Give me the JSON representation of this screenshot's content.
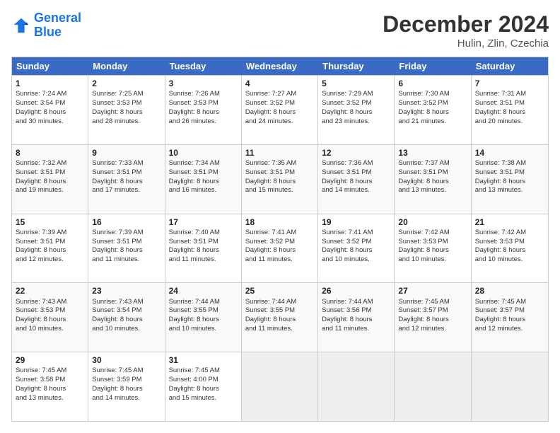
{
  "header": {
    "logo_line1": "General",
    "logo_line2": "Blue",
    "month_title": "December 2024",
    "location": "Hulin, Zlin, Czechia"
  },
  "calendar": {
    "days_of_week": [
      "Sunday",
      "Monday",
      "Tuesday",
      "Wednesday",
      "Thursday",
      "Friday",
      "Saturday"
    ],
    "rows": [
      [
        {
          "day": "1",
          "sunrise": "Sunrise: 7:24 AM",
          "sunset": "Sunset: 3:54 PM",
          "daylight": "Daylight: 8 hours and 30 minutes."
        },
        {
          "day": "2",
          "sunrise": "Sunrise: 7:25 AM",
          "sunset": "Sunset: 3:53 PM",
          "daylight": "Daylight: 8 hours and 28 minutes."
        },
        {
          "day": "3",
          "sunrise": "Sunrise: 7:26 AM",
          "sunset": "Sunset: 3:53 PM",
          "daylight": "Daylight: 8 hours and 26 minutes."
        },
        {
          "day": "4",
          "sunrise": "Sunrise: 7:27 AM",
          "sunset": "Sunset: 3:52 PM",
          "daylight": "Daylight: 8 hours and 24 minutes."
        },
        {
          "day": "5",
          "sunrise": "Sunrise: 7:29 AM",
          "sunset": "Sunset: 3:52 PM",
          "daylight": "Daylight: 8 hours and 23 minutes."
        },
        {
          "day": "6",
          "sunrise": "Sunrise: 7:30 AM",
          "sunset": "Sunset: 3:52 PM",
          "daylight": "Daylight: 8 hours and 21 minutes."
        },
        {
          "day": "7",
          "sunrise": "Sunrise: 7:31 AM",
          "sunset": "Sunset: 3:51 PM",
          "daylight": "Daylight: 8 hours and 20 minutes."
        }
      ],
      [
        {
          "day": "8",
          "sunrise": "Sunrise: 7:32 AM",
          "sunset": "Sunset: 3:51 PM",
          "daylight": "Daylight: 8 hours and 19 minutes."
        },
        {
          "day": "9",
          "sunrise": "Sunrise: 7:33 AM",
          "sunset": "Sunset: 3:51 PM",
          "daylight": "Daylight: 8 hours and 17 minutes."
        },
        {
          "day": "10",
          "sunrise": "Sunrise: 7:34 AM",
          "sunset": "Sunset: 3:51 PM",
          "daylight": "Daylight: 8 hours and 16 minutes."
        },
        {
          "day": "11",
          "sunrise": "Sunrise: 7:35 AM",
          "sunset": "Sunset: 3:51 PM",
          "daylight": "Daylight: 8 hours and 15 minutes."
        },
        {
          "day": "12",
          "sunrise": "Sunrise: 7:36 AM",
          "sunset": "Sunset: 3:51 PM",
          "daylight": "Daylight: 8 hours and 14 minutes."
        },
        {
          "day": "13",
          "sunrise": "Sunrise: 7:37 AM",
          "sunset": "Sunset: 3:51 PM",
          "daylight": "Daylight: 8 hours and 13 minutes."
        },
        {
          "day": "14",
          "sunrise": "Sunrise: 7:38 AM",
          "sunset": "Sunset: 3:51 PM",
          "daylight": "Daylight: 8 hours and 13 minutes."
        }
      ],
      [
        {
          "day": "15",
          "sunrise": "Sunrise: 7:39 AM",
          "sunset": "Sunset: 3:51 PM",
          "daylight": "Daylight: 8 hours and 12 minutes."
        },
        {
          "day": "16",
          "sunrise": "Sunrise: 7:39 AM",
          "sunset": "Sunset: 3:51 PM",
          "daylight": "Daylight: 8 hours and 11 minutes."
        },
        {
          "day": "17",
          "sunrise": "Sunrise: 7:40 AM",
          "sunset": "Sunset: 3:51 PM",
          "daylight": "Daylight: 8 hours and 11 minutes."
        },
        {
          "day": "18",
          "sunrise": "Sunrise: 7:41 AM",
          "sunset": "Sunset: 3:52 PM",
          "daylight": "Daylight: 8 hours and 11 minutes."
        },
        {
          "day": "19",
          "sunrise": "Sunrise: 7:41 AM",
          "sunset": "Sunset: 3:52 PM",
          "daylight": "Daylight: 8 hours and 10 minutes."
        },
        {
          "day": "20",
          "sunrise": "Sunrise: 7:42 AM",
          "sunset": "Sunset: 3:53 PM",
          "daylight": "Daylight: 8 hours and 10 minutes."
        },
        {
          "day": "21",
          "sunrise": "Sunrise: 7:42 AM",
          "sunset": "Sunset: 3:53 PM",
          "daylight": "Daylight: 8 hours and 10 minutes."
        }
      ],
      [
        {
          "day": "22",
          "sunrise": "Sunrise: 7:43 AM",
          "sunset": "Sunset: 3:53 PM",
          "daylight": "Daylight: 8 hours and 10 minutes."
        },
        {
          "day": "23",
          "sunrise": "Sunrise: 7:43 AM",
          "sunset": "Sunset: 3:54 PM",
          "daylight": "Daylight: 8 hours and 10 minutes."
        },
        {
          "day": "24",
          "sunrise": "Sunrise: 7:44 AM",
          "sunset": "Sunset: 3:55 PM",
          "daylight": "Daylight: 8 hours and 10 minutes."
        },
        {
          "day": "25",
          "sunrise": "Sunrise: 7:44 AM",
          "sunset": "Sunset: 3:55 PM",
          "daylight": "Daylight: 8 hours and 11 minutes."
        },
        {
          "day": "26",
          "sunrise": "Sunrise: 7:44 AM",
          "sunset": "Sunset: 3:56 PM",
          "daylight": "Daylight: 8 hours and 11 minutes."
        },
        {
          "day": "27",
          "sunrise": "Sunrise: 7:45 AM",
          "sunset": "Sunset: 3:57 PM",
          "daylight": "Daylight: 8 hours and 12 minutes."
        },
        {
          "day": "28",
          "sunrise": "Sunrise: 7:45 AM",
          "sunset": "Sunset: 3:57 PM",
          "daylight": "Daylight: 8 hours and 12 minutes."
        }
      ],
      [
        {
          "day": "29",
          "sunrise": "Sunrise: 7:45 AM",
          "sunset": "Sunset: 3:58 PM",
          "daylight": "Daylight: 8 hours and 13 minutes."
        },
        {
          "day": "30",
          "sunrise": "Sunrise: 7:45 AM",
          "sunset": "Sunset: 3:59 PM",
          "daylight": "Daylight: 8 hours and 14 minutes."
        },
        {
          "day": "31",
          "sunrise": "Sunrise: 7:45 AM",
          "sunset": "Sunset: 4:00 PM",
          "daylight": "Daylight: 8 hours and 15 minutes."
        },
        {
          "day": "",
          "sunrise": "",
          "sunset": "",
          "daylight": ""
        },
        {
          "day": "",
          "sunrise": "",
          "sunset": "",
          "daylight": ""
        },
        {
          "day": "",
          "sunrise": "",
          "sunset": "",
          "daylight": ""
        },
        {
          "day": "",
          "sunrise": "",
          "sunset": "",
          "daylight": ""
        }
      ]
    ]
  }
}
